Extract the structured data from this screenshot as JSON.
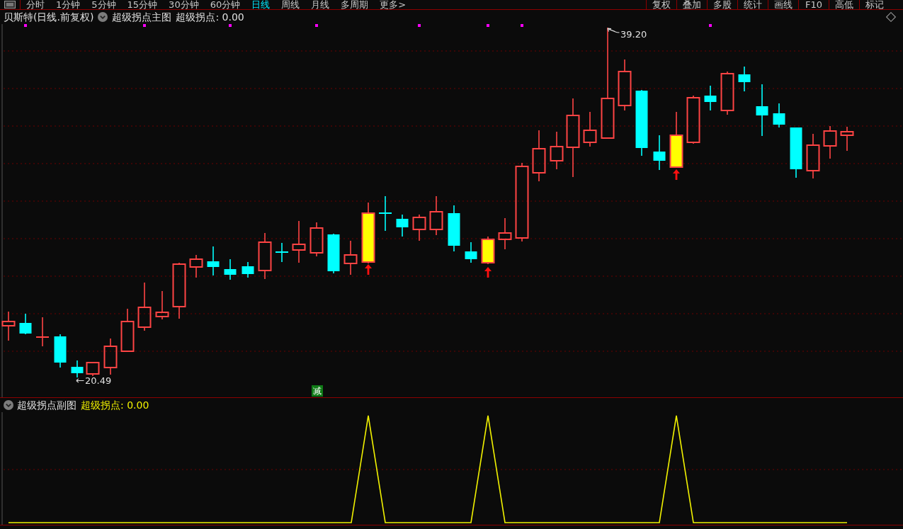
{
  "toolbar": {
    "period_tabs": [
      {
        "label": "分时",
        "selected": false
      },
      {
        "label": "1分钟",
        "selected": false
      },
      {
        "label": "5分钟",
        "selected": false
      },
      {
        "label": "15分钟",
        "selected": false
      },
      {
        "label": "30分钟",
        "selected": false
      },
      {
        "label": "60分钟",
        "selected": false
      },
      {
        "label": "日线",
        "selected": true
      },
      {
        "label": "周线",
        "selected": false
      },
      {
        "label": "月线",
        "selected": false
      },
      {
        "label": "多周期",
        "selected": false
      },
      {
        "label": "更多>",
        "selected": false
      }
    ],
    "tools": [
      "复权",
      "叠加",
      "多股",
      "统计",
      "画线",
      "F10",
      "高低",
      "标记"
    ]
  },
  "main_chart": {
    "title": "贝斯特(日线.前复权)",
    "indicator": "超级拐点主图",
    "reading": "超级拐点: 0.00",
    "high_label": "39.20",
    "low_label": "20.49",
    "badge": "减"
  },
  "sub_chart": {
    "indicator": "超级拐点副图",
    "reading": "超级拐点: 0.00"
  }
}
